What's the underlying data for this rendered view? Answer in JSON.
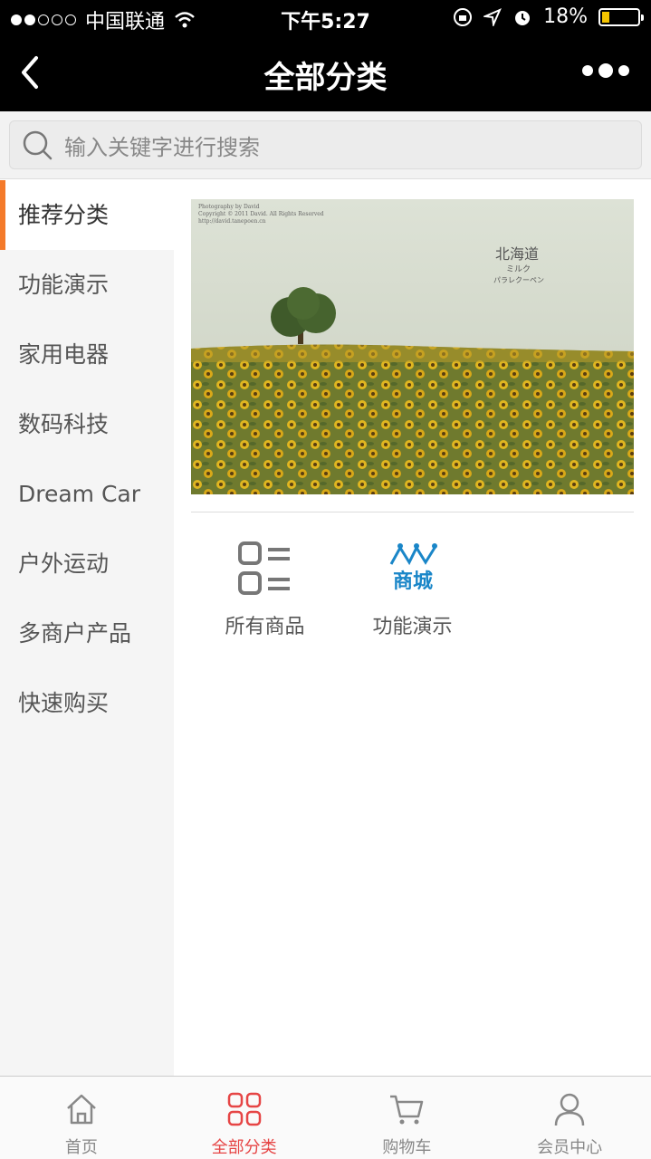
{
  "status_bar": {
    "carrier": "中国联通",
    "time": "下午5:27",
    "battery": "18%",
    "battery_level": 0.18
  },
  "nav": {
    "title": "全部分类"
  },
  "search": {
    "placeholder": "输入关键字进行搜索"
  },
  "sidebar": {
    "items": [
      {
        "label": "推荐分类"
      },
      {
        "label": "功能演示"
      },
      {
        "label": "家用电器"
      },
      {
        "label": "数码科技"
      },
      {
        "label": "Dream Car"
      },
      {
        "label": "户外运动"
      },
      {
        "label": "多商户产品"
      },
      {
        "label": "快速购买"
      }
    ]
  },
  "content": {
    "banner": {
      "photo_credit": "Photography by David",
      "copyright": "Copyright © 2011 David. All Rights Reserved",
      "url": "http://david.tanepoen.cn",
      "title_line1": "北海道",
      "title_line2": "ミルク",
      "title_line3": "パラレクーペン"
    },
    "grid": [
      {
        "label": "所有商品",
        "icon": "list-grid-icon"
      },
      {
        "label": "功能演示",
        "icon": "mall-logo-icon",
        "logo_text": "商城"
      }
    ]
  },
  "tab_bar": {
    "tabs": [
      {
        "label": "首页",
        "icon": "home-icon"
      },
      {
        "label": "全部分类",
        "icon": "category-icon"
      },
      {
        "label": "购物车",
        "icon": "cart-icon"
      },
      {
        "label": "会员中心",
        "icon": "user-icon"
      }
    ],
    "active_color": "#e64545",
    "inactive_color": "#888888"
  }
}
